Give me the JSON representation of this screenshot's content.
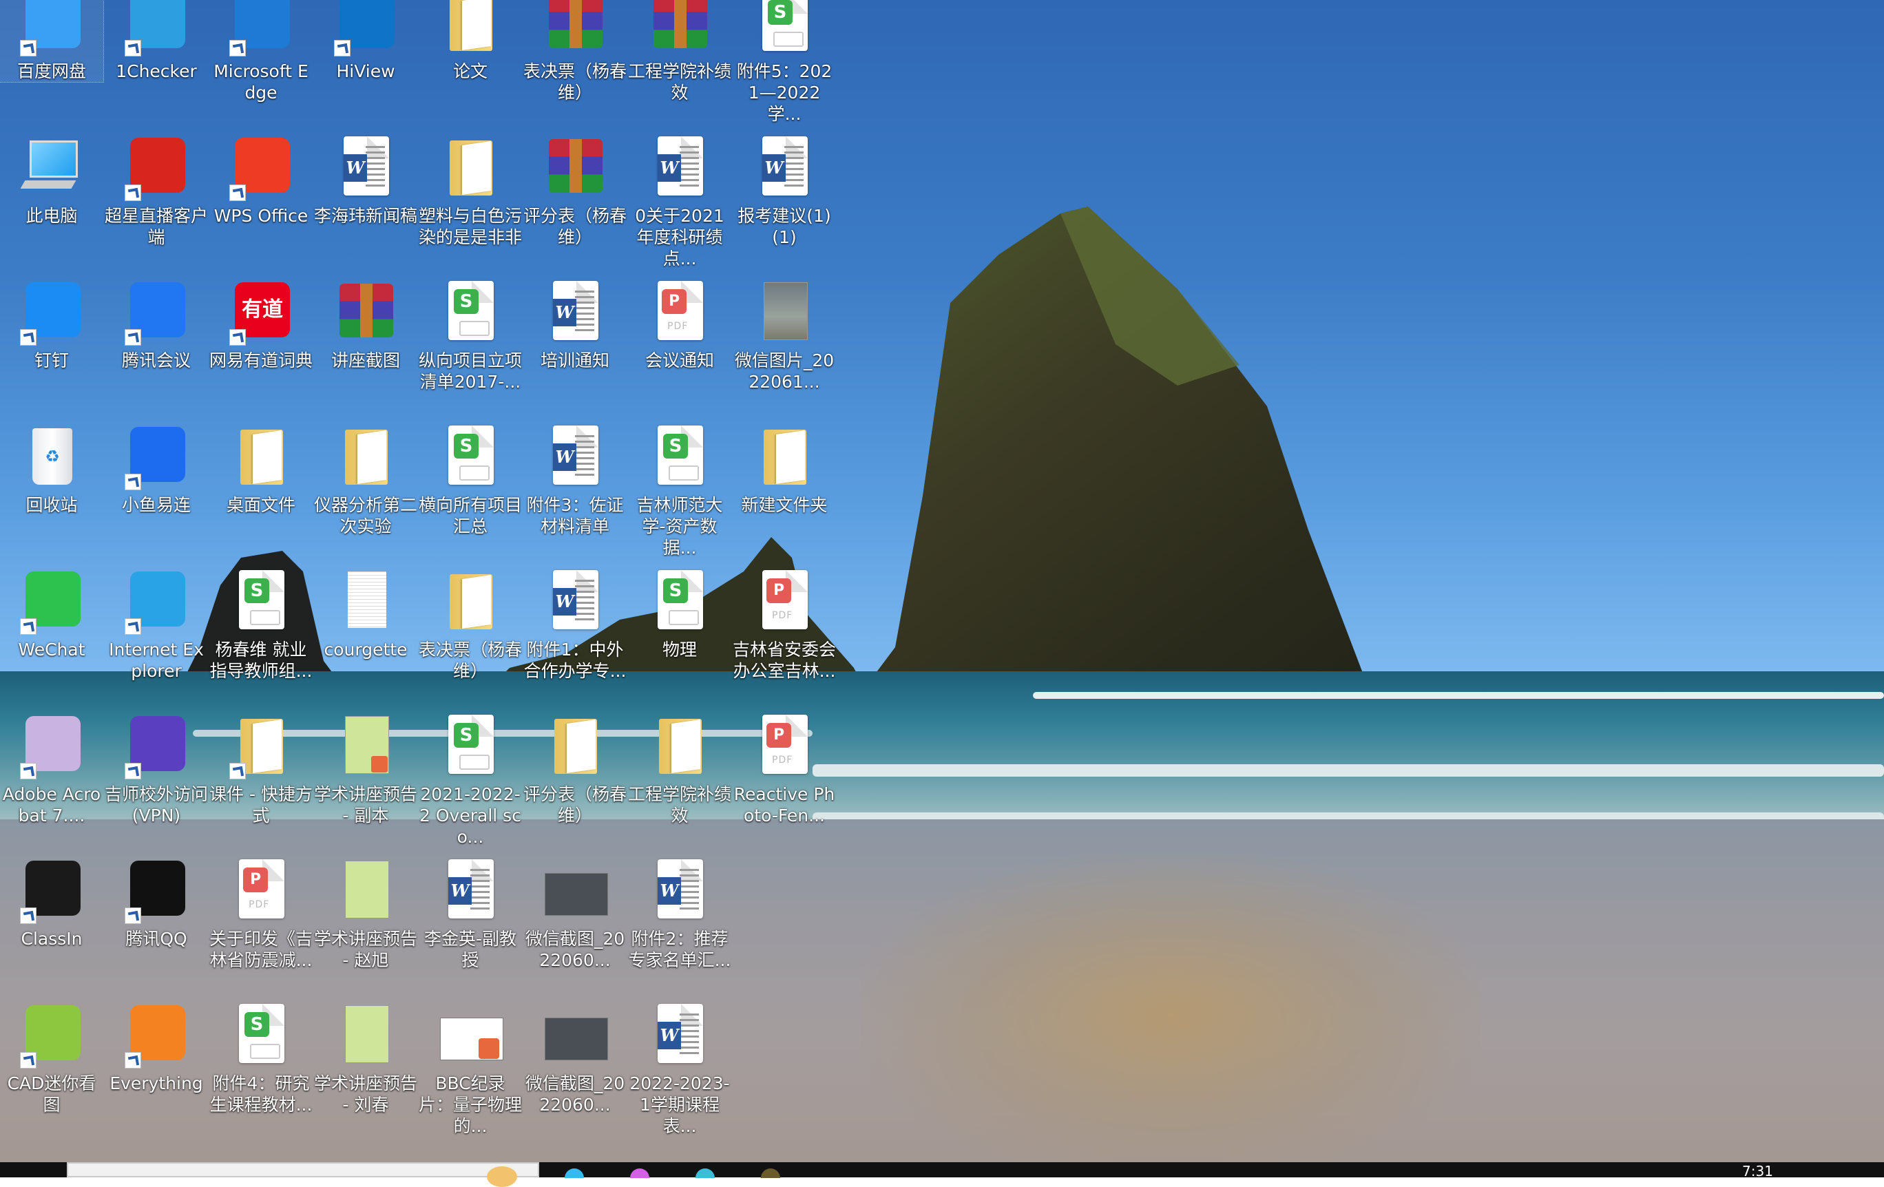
{
  "desktop": {
    "selected_icon": "百度网盘",
    "icons": [
      {
        "col": 0,
        "row": 0,
        "label": "百度网盘",
        "type": "app",
        "icon": "baidu-netdisk-icon",
        "shortcut": true,
        "color": "#3aa0f5"
      },
      {
        "col": 1,
        "row": 0,
        "label": "1Checker",
        "type": "app",
        "icon": "1checker-icon",
        "shortcut": true,
        "color": "#2d9ee0"
      },
      {
        "col": 2,
        "row": 0,
        "label": "Microsoft Edge",
        "type": "app",
        "icon": "edge-icon",
        "shortcut": true,
        "color": "#1f7ad6"
      },
      {
        "col": 3,
        "row": 0,
        "label": "HiView",
        "type": "app",
        "icon": "hiview-icon",
        "shortcut": true,
        "color": "#0f74c8"
      },
      {
        "col": 4,
        "row": 0,
        "label": "论文",
        "type": "folder",
        "icon": "folder-icon",
        "shortcut": false
      },
      {
        "col": 5,
        "row": 0,
        "label": "表决票（杨春维）",
        "type": "rar",
        "icon": "winrar-archive-icon",
        "shortcut": false
      },
      {
        "col": 6,
        "row": 0,
        "label": "工程学院补绩效",
        "type": "rar",
        "icon": "winrar-archive-icon",
        "shortcut": false
      },
      {
        "col": 7,
        "row": 0,
        "label": "附件5：2021—2022学...",
        "type": "sheet",
        "icon": "wps-spreadsheet-icon",
        "shortcut": false
      },
      {
        "col": 0,
        "row": 1,
        "label": "此电脑",
        "type": "pc",
        "icon": "this-pc-icon",
        "shortcut": false
      },
      {
        "col": 1,
        "row": 1,
        "label": "超星直播客户端",
        "type": "app",
        "icon": "chaoxing-live-icon",
        "shortcut": true,
        "color": "#d8261f"
      },
      {
        "col": 2,
        "row": 1,
        "label": "WPS Office",
        "type": "app",
        "icon": "wps-office-icon",
        "shortcut": true,
        "color": "#ee3b24"
      },
      {
        "col": 3,
        "row": 1,
        "label": "李海玮新闻稿",
        "type": "word",
        "icon": "word-document-icon",
        "shortcut": false
      },
      {
        "col": 4,
        "row": 1,
        "label": "塑料与白色污染的是是非非",
        "type": "folder",
        "icon": "folder-icon",
        "shortcut": false
      },
      {
        "col": 5,
        "row": 1,
        "label": "评分表（杨春维）",
        "type": "rar",
        "icon": "winrar-archive-icon",
        "shortcut": false
      },
      {
        "col": 6,
        "row": 1,
        "label": "0关于2021年度科研绩点...",
        "type": "word",
        "icon": "word-document-icon",
        "shortcut": false
      },
      {
        "col": 7,
        "row": 1,
        "label": "报考建议(1)(1)",
        "type": "word",
        "icon": "word-document-icon",
        "shortcut": false
      },
      {
        "col": 0,
        "row": 2,
        "label": "钉钉",
        "type": "app",
        "icon": "dingtalk-icon",
        "shortcut": true,
        "color": "#1c8cf5"
      },
      {
        "col": 1,
        "row": 2,
        "label": "腾讯会议",
        "type": "app",
        "icon": "tencent-meeting-icon",
        "shortcut": true,
        "color": "#2176f2"
      },
      {
        "col": 2,
        "row": 2,
        "label": "网易有道词典",
        "type": "app",
        "icon": "youdao-dict-icon",
        "shortcut": true,
        "color": "#e8001c",
        "glyph": "有道"
      },
      {
        "col": 3,
        "row": 2,
        "label": "讲座截图",
        "type": "rar",
        "icon": "winrar-archive-icon",
        "shortcut": false
      },
      {
        "col": 4,
        "row": 2,
        "label": "纵向项目立项清单2017-...",
        "type": "sheet",
        "icon": "wps-spreadsheet-icon",
        "shortcut": false
      },
      {
        "col": 5,
        "row": 2,
        "label": "培训通知",
        "type": "word",
        "icon": "word-document-icon",
        "shortcut": false
      },
      {
        "col": 6,
        "row": 2,
        "label": "会议通知",
        "type": "pdf",
        "icon": "pdf-icon",
        "shortcut": false
      },
      {
        "col": 7,
        "row": 2,
        "label": "微信图片_2022061...",
        "type": "photo",
        "icon": "image-thumbnail-icon",
        "shortcut": false
      },
      {
        "col": 0,
        "row": 3,
        "label": "回收站",
        "type": "recycle",
        "icon": "recycle-bin-icon",
        "shortcut": false
      },
      {
        "col": 1,
        "row": 3,
        "label": "小鱼易连",
        "type": "app",
        "icon": "xiaoyu-yilian-icon",
        "shortcut": true,
        "color": "#1d6cf0"
      },
      {
        "col": 2,
        "row": 3,
        "label": "桌面文件",
        "type": "folder",
        "icon": "folder-icon",
        "shortcut": false
      },
      {
        "col": 3,
        "row": 3,
        "label": "仪器分析第二次实验",
        "type": "folder",
        "icon": "folder-icon",
        "shortcut": false
      },
      {
        "col": 4,
        "row": 3,
        "label": "横向所有项目汇总",
        "type": "sheet",
        "icon": "wps-spreadsheet-icon",
        "shortcut": false
      },
      {
        "col": 5,
        "row": 3,
        "label": "附件3：佐证材料清单",
        "type": "word",
        "icon": "word-document-icon",
        "shortcut": false
      },
      {
        "col": 6,
        "row": 3,
        "label": "吉林师范大学-资产数据...",
        "type": "sheet",
        "icon": "wps-spreadsheet-icon",
        "shortcut": false
      },
      {
        "col": 7,
        "row": 3,
        "label": "新建文件夹",
        "type": "folder",
        "icon": "folder-icon",
        "shortcut": false
      },
      {
        "col": 0,
        "row": 4,
        "label": "WeChat",
        "type": "app",
        "icon": "wechat-icon",
        "shortcut": true,
        "color": "#2dc14e"
      },
      {
        "col": 1,
        "row": 4,
        "label": "Internet Explorer",
        "type": "app",
        "icon": "internet-explorer-icon",
        "shortcut": true,
        "color": "#2aa3e6"
      },
      {
        "col": 2,
        "row": 4,
        "label": "杨春维 就业指导教师组...",
        "type": "sheet",
        "icon": "wps-spreadsheet-icon",
        "shortcut": false
      },
      {
        "col": 3,
        "row": 4,
        "label": "courgette",
        "type": "text",
        "icon": "text-file-icon",
        "shortcut": false
      },
      {
        "col": 4,
        "row": 4,
        "label": "表决票（杨春维）",
        "type": "folder",
        "icon": "folder-icon",
        "shortcut": false
      },
      {
        "col": 5,
        "row": 4,
        "label": "附件1：中外合作办学专...",
        "type": "word",
        "icon": "word-document-icon",
        "shortcut": false
      },
      {
        "col": 6,
        "row": 4,
        "label": "物理",
        "type": "sheet",
        "icon": "wps-spreadsheet-icon",
        "shortcut": false
      },
      {
        "col": 7,
        "row": 4,
        "label": "吉林省安委会办公室吉林...",
        "type": "pdf",
        "icon": "pdf-icon",
        "shortcut": false
      },
      {
        "col": 0,
        "row": 5,
        "label": "Adobe Acrobat 7....",
        "type": "app",
        "icon": "adobe-acrobat-icon",
        "shortcut": true,
        "color": "#c9b3e0"
      },
      {
        "col": 1,
        "row": 5,
        "label": "吉师校外访问(VPN)",
        "type": "app",
        "icon": "vpn-globe-icon",
        "shortcut": true,
        "color": "#5a3fc0"
      },
      {
        "col": 2,
        "row": 5,
        "label": "课件 - 快捷方式",
        "type": "folder",
        "icon": "folder-shortcut-icon",
        "shortcut": true
      },
      {
        "col": 3,
        "row": 5,
        "label": "学术讲座预告 - 副本",
        "type": "ppt",
        "icon": "presentation-thumbnail-icon",
        "shortcut": false
      },
      {
        "col": 4,
        "row": 5,
        "label": "2021-2022-2 Overall sco...",
        "type": "sheet",
        "icon": "wps-spreadsheet-icon",
        "shortcut": false
      },
      {
        "col": 5,
        "row": 5,
        "label": "评分表（杨春维）",
        "type": "folder",
        "icon": "folder-icon",
        "shortcut": false
      },
      {
        "col": 6,
        "row": 5,
        "label": "工程学院补绩效",
        "type": "folder",
        "icon": "folder-icon",
        "shortcut": false
      },
      {
        "col": 7,
        "row": 5,
        "label": "Reactive Photo-Fen...",
        "type": "pdf",
        "icon": "pdf-icon",
        "shortcut": false
      },
      {
        "col": 0,
        "row": 6,
        "label": "ClassIn",
        "type": "app",
        "icon": "classin-icon",
        "shortcut": true,
        "color": "#1a1a1a"
      },
      {
        "col": 1,
        "row": 6,
        "label": "腾讯QQ",
        "type": "app",
        "icon": "tencent-qq-icon",
        "shortcut": true,
        "color": "#111111"
      },
      {
        "col": 2,
        "row": 6,
        "label": "关于印发《吉林省防震减...",
        "type": "pdf",
        "icon": "pdf-icon",
        "shortcut": false
      },
      {
        "col": 3,
        "row": 6,
        "label": "学术讲座预告 - 赵旭",
        "type": "photo-poster",
        "icon": "poster-thumbnail-icon",
        "shortcut": false
      },
      {
        "col": 4,
        "row": 6,
        "label": "李金英-副教授",
        "type": "word",
        "icon": "word-document-icon",
        "shortcut": false
      },
      {
        "col": 5,
        "row": 6,
        "label": "微信截图_2022060...",
        "type": "screenshot",
        "icon": "screenshot-thumbnail-icon",
        "shortcut": false
      },
      {
        "col": 6,
        "row": 6,
        "label": "附件2：推荐专家名单汇...",
        "type": "word",
        "icon": "word-document-icon",
        "shortcut": false
      },
      {
        "col": 0,
        "row": 7,
        "label": "CAD迷你看图",
        "type": "app",
        "icon": "cad-viewer-icon",
        "shortcut": true,
        "color": "#8dc63f"
      },
      {
        "col": 1,
        "row": 7,
        "label": "Everything",
        "type": "app",
        "icon": "everything-search-icon",
        "shortcut": true,
        "color": "#f58220"
      },
      {
        "col": 2,
        "row": 7,
        "label": "附件4：研究生课程教材...",
        "type": "sheet",
        "icon": "wps-spreadsheet-icon",
        "shortcut": false
      },
      {
        "col": 3,
        "row": 7,
        "label": "学术讲座预告 - 刘春",
        "type": "photo-poster",
        "icon": "poster-thumbnail-icon",
        "shortcut": false
      },
      {
        "col": 4,
        "row": 7,
        "label": "BBC纪录片：量子物理的...",
        "type": "ppt-wide",
        "icon": "presentation-thumbnail-icon",
        "shortcut": false
      },
      {
        "col": 5,
        "row": 7,
        "label": "微信截图_2022060...",
        "type": "screenshot",
        "icon": "screenshot-thumbnail-icon",
        "shortcut": false
      },
      {
        "col": 6,
        "row": 7,
        "label": "2022-2023-1学期课程表...",
        "type": "word",
        "icon": "word-document-icon",
        "shortcut": false
      }
    ]
  },
  "taskbar": {
    "search_placeholder": "",
    "pinned": [
      {
        "name": "task-view-icon",
        "color": "#37b8f0"
      },
      {
        "name": "app-pink-icon",
        "color": "#d45ee6"
      },
      {
        "name": "app-teal-icon",
        "color": "#3bbcd8"
      },
      {
        "name": "app-brown-icon",
        "color": "#6b5a2a"
      }
    ],
    "clock_time": "7:31"
  }
}
